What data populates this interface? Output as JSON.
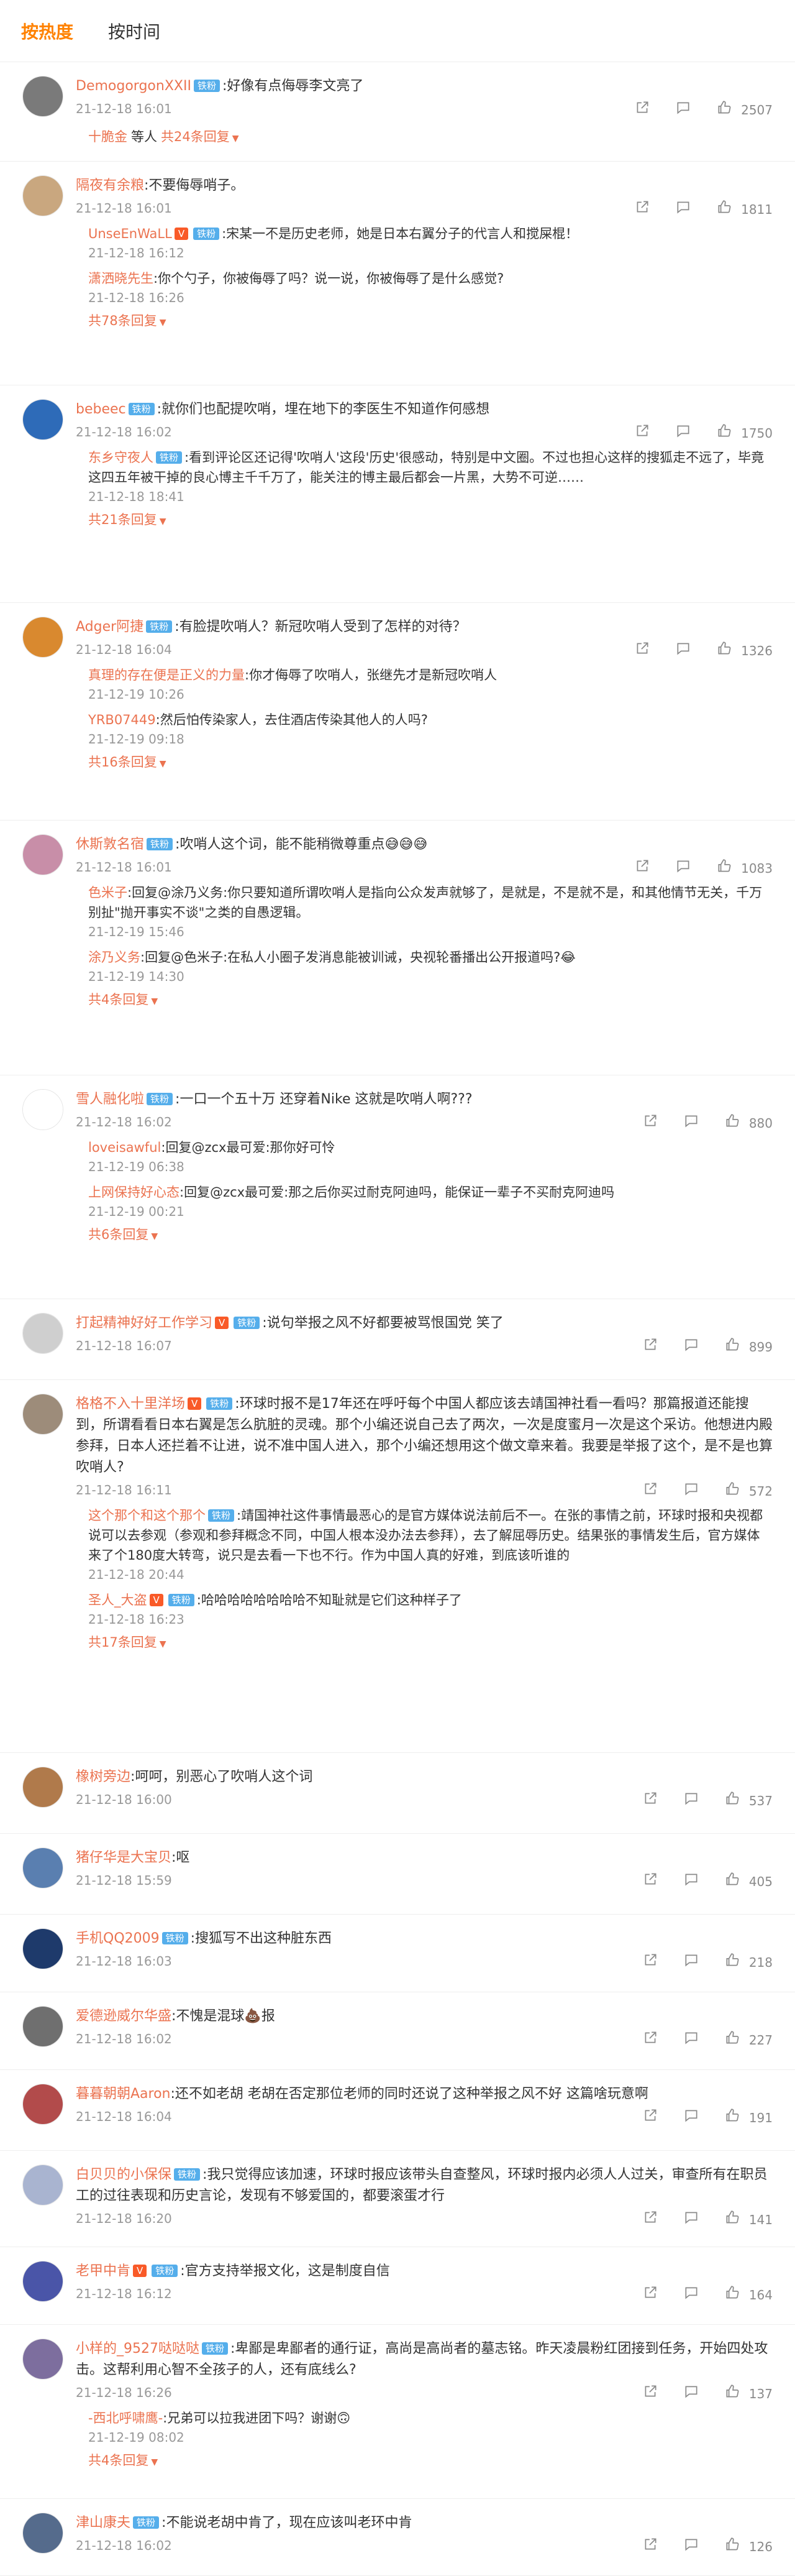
{
  "tabs": [
    {
      "label": "按热度",
      "active": true
    },
    {
      "label": "按时间",
      "active": false
    }
  ],
  "colors": {
    "accent": "#ff8200",
    "username": "#eb7350",
    "fan_badge": "#55aeeb",
    "vip_badge": "#f95a28",
    "meta": "#999999"
  },
  "comments": [
    {
      "user": "DemogorgonXXII",
      "badge": "铁粉",
      "vip": false,
      "text": ":好像有点侮辱李文亮了",
      "time": "21-12-18 16:01",
      "likes": "2507",
      "reply_summary": {
        "who": "十脆金",
        "suffix": "等人",
        "more": "共24条回复"
      },
      "replies": []
    },
    {
      "user": "隔夜有余粮",
      "badge": "",
      "vip": false,
      "text": ":不要侮辱哨子。",
      "time": "21-12-18 16:01",
      "likes": "1811",
      "replies": [
        {
          "user": "UnseEnWaLL",
          "vip": true,
          "badge": "铁粉",
          "text": ":宋某一不是历史老师，她是日本右翼分子的代言人和搅屎棍！",
          "time": "21-12-18 16:12"
        },
        {
          "user": "潇洒晓先生",
          "vip": false,
          "badge": "",
          "text": ":你个勺子，你被侮辱了吗？说一说，你被侮辱了是什么感觉?",
          "time": "21-12-18 16:26"
        }
      ],
      "more": "共78条回复"
    },
    {
      "user": "bebeec",
      "badge": "铁粉",
      "vip": false,
      "text": ":就你们也配提吹哨，埋在地下的李医生不知道作何感想",
      "time": "21-12-18 16:02",
      "likes": "1750",
      "replies": [
        {
          "user": "东乡守夜人",
          "vip": false,
          "badge": "铁粉",
          "text": ":看到评论区还记得'吹哨人'这段'历史'很感动，特别是中文圈。不过也担心这样的搜狐走不远了，毕竟这四五年被干掉的良心博主千千万了，能关注的博主最后都会一片黑，大势不可逆……",
          "time": "21-12-18 18:41"
        }
      ],
      "more": "共21条回复"
    },
    {
      "user": "Adger阿捷",
      "badge": "铁粉",
      "vip": false,
      "text": ":有脸提吹哨人？新冠吹哨人受到了怎样的对待？",
      "time": "21-12-18 16:04",
      "likes": "1326",
      "replies": [
        {
          "user": "真理的存在便是正义的力量",
          "vip": false,
          "badge": "",
          "text": ":你才侮辱了吹哨人，张继先才是新冠吹哨人",
          "time": "21-12-19 10:26"
        },
        {
          "user": "YRB07449",
          "vip": false,
          "badge": "",
          "text": ":然后怕传染家人，去住酒店传染其他人的人吗?",
          "time": "21-12-19 09:18"
        }
      ],
      "more": "共16条回复"
    },
    {
      "user": "休斯敦名宿",
      "badge": "铁粉",
      "vip": false,
      "text": ":吹哨人这个词，能不能稍微尊重点😅😅😅",
      "time": "21-12-18 16:01",
      "likes": "1083",
      "replies": [
        {
          "user": "色米子",
          "vip": false,
          "badge": "",
          "text": ":回复@涂乃义务:你只要知道所谓吹哨人是指向公众发声就够了，是就是，不是就不是，和其他情节无关，千万别扯\"抛开事实不谈\"之类的自愚逻辑。",
          "time": "21-12-19 15:46"
        },
        {
          "user": "涂乃义务",
          "vip": false,
          "badge": "",
          "text": ":回复@色米子:在私人小圈子发消息能被训诫，央视轮番播出公开报道吗?😂",
          "time": "21-12-19 14:30"
        }
      ],
      "more": "共4条回复"
    },
    {
      "user": "雪人融化啦",
      "badge": "铁粉",
      "vip": false,
      "text": ":一口一个五十万 还穿着Nike 这就是吹哨人啊???",
      "time": "21-12-18 16:02",
      "likes": "880",
      "replies": [
        {
          "user": "loveisawful",
          "vip": false,
          "badge": "",
          "text": ":回复@zcx最可爱:那你好可怜",
          "time": "21-12-19 06:38"
        },
        {
          "user": "上网保持好心态",
          "vip": false,
          "badge": "",
          "text": ":回复@zcx最可爱:那之后你买过耐克阿迪吗，能保证一辈子不买耐克阿迪吗",
          "time": "21-12-19 00:21"
        }
      ],
      "more": "共6条回复"
    },
    {
      "user": "打起精神好好工作学习",
      "badge": "铁粉",
      "vip": true,
      "text": ":说句举报之风不好都要被骂恨国党 笑了",
      "time": "21-12-18 16:07",
      "likes": "899",
      "replies": []
    },
    {
      "user": "格格不入十里洋场",
      "badge": "铁粉",
      "vip": true,
      "text": ":环球时报不是17年还在呼吁每个中国人都应该去靖国神社看一看吗？那篇报道还能搜到，所谓看看日本右翼是怎么肮脏的灵魂。那个小编还说自己去了两次，一次是度蜜月一次是这个采访。他想进内殿参拜，日本人还拦着不让进，说不准中国人进入，那个小编还想用这个做文章来着。我要是举报了这个，是不是也算吹哨人?",
      "time": "21-12-18 16:11",
      "likes": "572",
      "replies": [
        {
          "user": "这个那个和这个那个",
          "vip": false,
          "badge": "铁粉",
          "text": ":靖国神社这件事情最恶心的是官方媒体说法前后不一。在张的事情之前，环球时报和央视都说可以去参观（参观和参拜概念不同，中国人根本没办法去参拜），去了解屈辱历史。结果张的事情发生后，官方媒体来了个180度大转弯，说只是去看一下也不行。作为中国人真的好难，到底该听谁的",
          "time": "21-12-18 20:44"
        },
        {
          "user": "圣人_大盗",
          "vip": true,
          "badge": "铁粉",
          "text": ":哈哈哈哈哈哈哈哈不知耻就是它们这种样子了",
          "time": "21-12-18 16:23"
        }
      ],
      "more": "共17条回复"
    },
    {
      "user": "橡树旁边",
      "badge": "",
      "vip": false,
      "text": ":呵呵，别恶心了吹哨人这个词",
      "time": "21-12-18 16:00",
      "likes": "537",
      "replies": []
    },
    {
      "user": "猪仔华是大宝贝",
      "badge": "",
      "vip": false,
      "text": ":呕",
      "time": "21-12-18 15:59",
      "likes": "405",
      "replies": []
    },
    {
      "user": "手机QQ2009",
      "badge": "铁粉",
      "vip": false,
      "text": ":搜狐写不出这种脏东西",
      "time": "21-12-18 16:03",
      "likes": "218",
      "replies": []
    },
    {
      "user": "爱德逊威尔华盛",
      "badge": "",
      "vip": false,
      "text": ":不愧是混球💩报",
      "time": "21-12-18 16:02",
      "likes": "227",
      "replies": []
    },
    {
      "user": "暮暮朝朝Aaron",
      "badge": "",
      "vip": false,
      "text": ":还不如老胡 老胡在否定那位老师的同时还说了这种举报之风不好 这篇啥玩意啊",
      "time": "21-12-18 16:04",
      "likes": "191",
      "replies": []
    },
    {
      "user": "白贝贝的小保保",
      "badge": "铁粉",
      "vip": false,
      "text": ":我只觉得应该加速，环球时报应该带头自查整风，环球时报内必须人人过关，审查所有在职员工的过往表现和历史言论，发现有不够爱国的，都要滚蛋才行",
      "time": "21-12-18 16:20",
      "likes": "141",
      "replies": []
    },
    {
      "user": "老甲中肯",
      "badge": "铁粉",
      "vip": true,
      "text": ":官方支持举报文化，这是制度自信",
      "time": "21-12-18 16:12",
      "likes": "164",
      "replies": []
    },
    {
      "user": "小样的_9527哒哒哒",
      "badge": "铁粉",
      "vip": false,
      "text": ":卑鄙是卑鄙者的通行证，高尚是高尚者的墓志铭。昨天凌晨粉红团接到任务，开始四处攻击。这帮利用心智不全孩子的人，还有底线么?",
      "time": "21-12-18 16:26",
      "likes": "137",
      "replies": [
        {
          "user": "-西北呼啸鹰-",
          "vip": false,
          "badge": "",
          "text": ":兄弟可以拉我进团下吗？谢谢🙃",
          "time": "21-12-19 08:02"
        }
      ],
      "more": "共4条回复"
    },
    {
      "user": "津山康夫",
      "badge": "铁粉",
      "vip": false,
      "text": ":不能说老胡中肯了，现在应该叫老环中肯",
      "time": "21-12-18 16:02",
      "likes": "126",
      "replies": []
    }
  ]
}
